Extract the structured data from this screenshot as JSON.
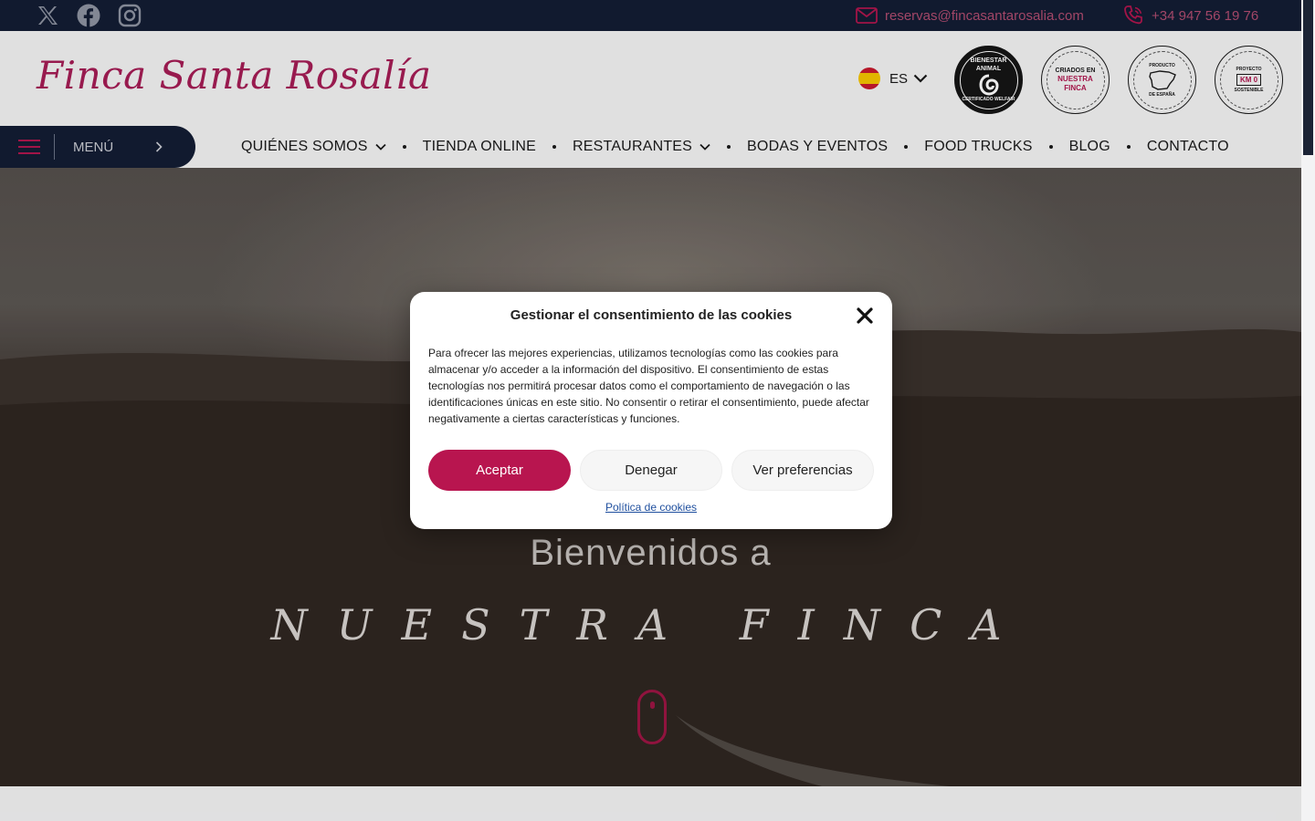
{
  "topbar": {
    "social": [
      "x-icon",
      "facebook-icon",
      "instagram-icon"
    ],
    "email": "reservas@fincasantarosalia.com",
    "phone": "+34 947 56 19 76"
  },
  "header": {
    "logo_text": "Finca Santa Rosalía",
    "language": "ES",
    "badges": {
      "b1": {
        "line1": "BIENESTAR ANIMAL",
        "line2": "CERTIFICADO WELFAIR"
      },
      "b2": {
        "line1": "CRIADOS EN",
        "line2": "NUESTRA",
        "line3": "FINCA"
      },
      "b3": {
        "line1": "PRODUCTO",
        "line2": "DE ESPAÑA"
      },
      "b4": {
        "line1": "PROYECTO",
        "line2": "KM 0",
        "line3": "SOSTENIBLE"
      }
    },
    "menu_label": "MENÚ"
  },
  "nav": {
    "items": [
      "QUIÉNES SOMOS",
      "TIENDA ONLINE",
      "RESTAURANTES",
      "BODAS Y EVENTOS",
      "FOOD TRUCKS",
      "BLOG",
      "CONTACTO"
    ]
  },
  "hero": {
    "welcome": "Bienvenidos a",
    "title": "NUESTRA FINCA"
  },
  "cookie_dialog": {
    "title": "Gestionar el consentimiento de las cookies",
    "body": "Para ofrecer las mejores experiencias, utilizamos tecnologías como las cookies para almacenar y/o acceder a la información del dispositivo. El consentimiento de estas tecnologías nos permitirá procesar datos como el comportamiento de navegación o las identificaciones únicas en este sitio. No consentir o retirar el consentimiento, puede afectar negativamente a ciertas características y funciones.",
    "accept": "Aceptar",
    "deny": "Denegar",
    "preferences": "Ver preferencias",
    "policy_link": "Política de cookies"
  },
  "colors": {
    "brand": "#a51d55",
    "accent_button": "#b8154f",
    "dark_navy": "#131d33"
  }
}
